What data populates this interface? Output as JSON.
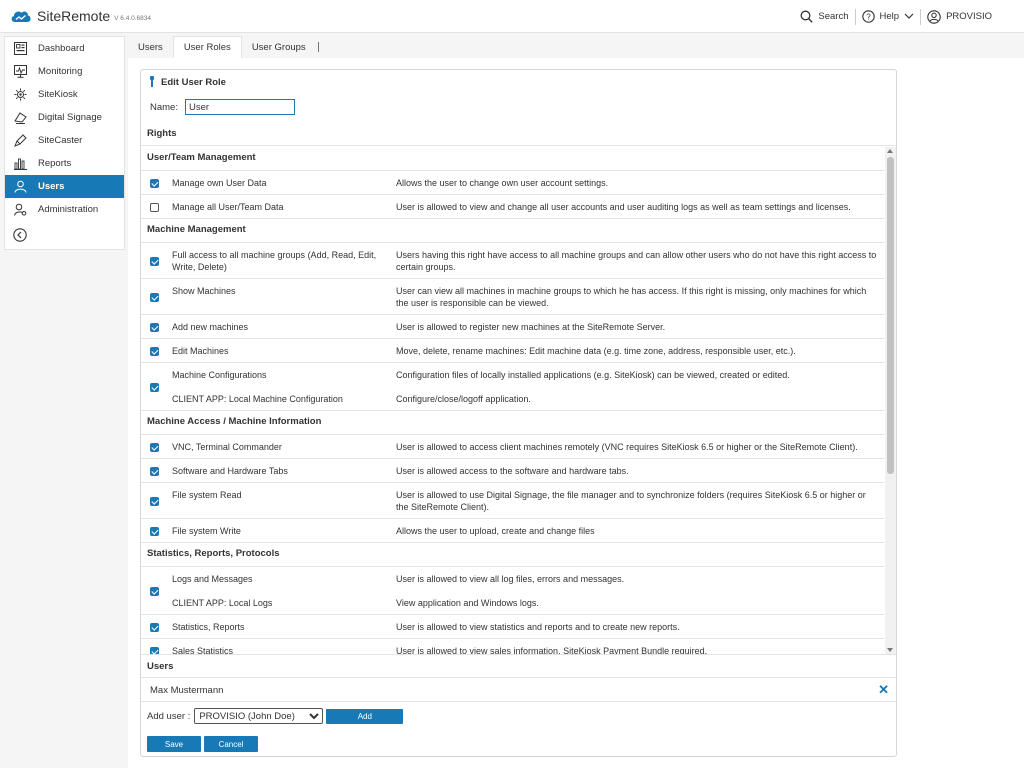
{
  "app": {
    "name": "SiteRemote",
    "version": "V 6.4.0.6834"
  },
  "header": {
    "search_label": "Search",
    "help_label": "Help",
    "account_label": "PROVISIO"
  },
  "sidebar": {
    "items": [
      {
        "label": "Dashboard",
        "icon": "dashboard-icon",
        "active": false
      },
      {
        "label": "Monitoring",
        "icon": "monitoring-icon",
        "active": false
      },
      {
        "label": "SiteKiosk",
        "icon": "sitekiosk-icon",
        "active": false
      },
      {
        "label": "Digital Signage",
        "icon": "digital-signage-icon",
        "active": false
      },
      {
        "label": "SiteCaster",
        "icon": "sitecaster-icon",
        "active": false
      },
      {
        "label": "Reports",
        "icon": "reports-icon",
        "active": false
      },
      {
        "label": "Users",
        "icon": "users-icon",
        "active": true
      },
      {
        "label": "Administration",
        "icon": "administration-icon",
        "active": false
      }
    ]
  },
  "tabs": [
    {
      "label": "Users",
      "active": false
    },
    {
      "label": "User Roles",
      "active": true
    },
    {
      "label": "User Groups",
      "active": false
    }
  ],
  "panel": {
    "title": "Edit User Role",
    "name_label": "Name:",
    "name_value": "User",
    "rights_heading": "Rights"
  },
  "rights": [
    {
      "section": "User/Team Management",
      "rows": [
        {
          "checked": true,
          "lines": [
            {
              "label": "Manage own User Data",
              "desc": "Allows the user to change own user account settings."
            }
          ]
        },
        {
          "checked": false,
          "lines": [
            {
              "label": "Manage all User/Team Data",
              "desc": "User is allowed to view and change all user accounts and user auditing logs as well as team settings and licenses."
            }
          ]
        }
      ]
    },
    {
      "section": "Machine Management",
      "rows": [
        {
          "checked": true,
          "lines": [
            {
              "label": "Full access to all machine groups (Add, Read, Edit, Write, Delete)",
              "desc": "Users having this right have access to all machine groups and can allow other users who do not have this right access to certain groups."
            }
          ]
        },
        {
          "checked": true,
          "lines": [
            {
              "label": "Show Machines",
              "desc": "User can view all machines in machine groups to which he has access. If this right is missing, only machines for which the user is responsible can be viewed."
            }
          ]
        },
        {
          "checked": true,
          "lines": [
            {
              "label": "Add new machines",
              "desc": "User is allowed to register new machines at the SiteRemote Server."
            }
          ]
        },
        {
          "checked": true,
          "lines": [
            {
              "label": "Edit Machines",
              "desc": "Move, delete, rename machines: Edit machine data (e.g. time zone, address, responsible user, etc.)."
            }
          ]
        },
        {
          "checked": true,
          "lines": [
            {
              "label": "Machine Configurations",
              "desc": "Configuration files of locally installed applications (e.g. SiteKiosk) can be viewed, created or edited."
            },
            {
              "label": "CLIENT APP: Local Machine Configuration",
              "desc": "Configure/close/logoff application."
            }
          ]
        }
      ]
    },
    {
      "section": "Machine Access / Machine Information",
      "rows": [
        {
          "checked": true,
          "lines": [
            {
              "label": "VNC, Terminal Commander",
              "desc": "User is allowed to access client machines remotely (VNC requires SiteKiosk 6.5 or higher or the SiteRemote Client)."
            }
          ]
        },
        {
          "checked": true,
          "lines": [
            {
              "label": "Software and Hardware Tabs",
              "desc": "User is allowed access to the software and hardware tabs."
            }
          ]
        },
        {
          "checked": true,
          "lines": [
            {
              "label": "File system Read",
              "desc": "User is allowed to use Digital Signage, the file manager and to synchronize folders (requires SiteKiosk 6.5 or higher or the SiteRemote Client)."
            }
          ]
        },
        {
          "checked": true,
          "lines": [
            {
              "label": "File system Write",
              "desc": "Allows the user to upload, create and change files"
            }
          ]
        }
      ]
    },
    {
      "section": "Statistics, Reports, Protocols",
      "rows": [
        {
          "checked": true,
          "lines": [
            {
              "label": "Logs and Messages",
              "desc": "User is allowed to view all log files, errors and messages."
            },
            {
              "label": "CLIENT APP: Local Logs",
              "desc": "View application and Windows logs."
            }
          ]
        },
        {
          "checked": true,
          "lines": [
            {
              "label": "Statistics, Reports",
              "desc": "User is allowed to view statistics and reports and to create new reports."
            }
          ]
        },
        {
          "checked": true,
          "lines": [
            {
              "label": "Sales Statistics",
              "desc": "User is allowed to view sales information. SiteKiosk Payment Bundle required."
            }
          ]
        }
      ]
    }
  ],
  "users": {
    "heading": "Users",
    "list": [
      {
        "name": "Max Mustermann"
      }
    ],
    "add_label": "Add user :",
    "add_select_value": "PROVISIO (John Doe)",
    "add_button": "Add"
  },
  "actions": {
    "save_label": "Save",
    "cancel_label": "Cancel"
  },
  "colors": {
    "accent": "#1779b6"
  }
}
